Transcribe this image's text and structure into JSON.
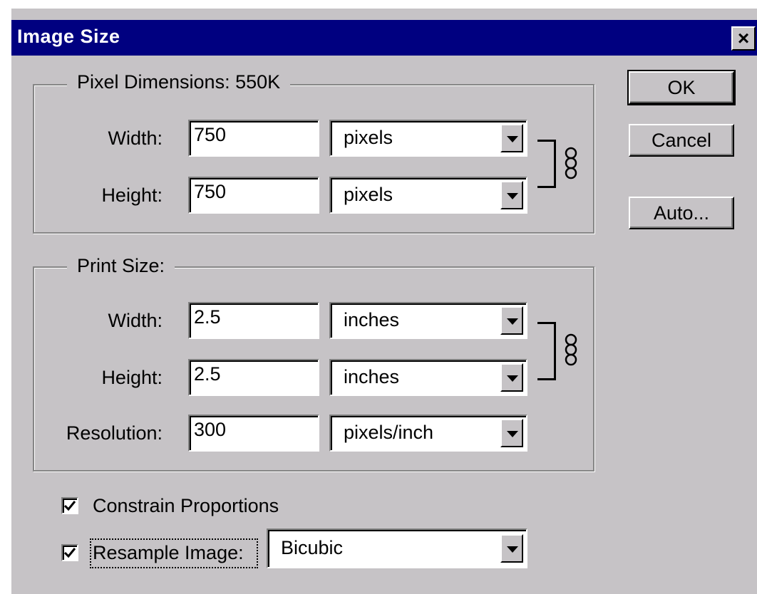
{
  "window": {
    "title": "Image Size"
  },
  "buttons": {
    "ok": "OK",
    "cancel": "Cancel",
    "auto": "Auto..."
  },
  "pixel_dimensions": {
    "legend": "Pixel Dimensions:  550K",
    "width_label": "Width:",
    "height_label": "Height:",
    "width_value": "750",
    "height_value": "750",
    "width_unit": "pixels",
    "height_unit": "pixels"
  },
  "print_size": {
    "legend": "Print Size:",
    "width_label": "Width:",
    "height_label": "Height:",
    "resolution_label": "Resolution:",
    "width_value": "2.5",
    "height_value": "2.5",
    "resolution_value": "300",
    "width_unit": "inches",
    "height_unit": "inches",
    "resolution_unit": "pixels/inch"
  },
  "options": {
    "constrain_label": "Constrain Proportions",
    "constrain_checked": true,
    "resample_label": "Resample Image:",
    "resample_checked": true,
    "resample_method": "Bicubic"
  },
  "colors": {
    "face": "#c6c3c6",
    "titlebar": "#000080",
    "field": "#ffffff"
  },
  "icons": {
    "close": "close-icon",
    "link": "chain-link-icon",
    "dropdown": "chevron-down-icon",
    "check": "checkmark-icon"
  }
}
